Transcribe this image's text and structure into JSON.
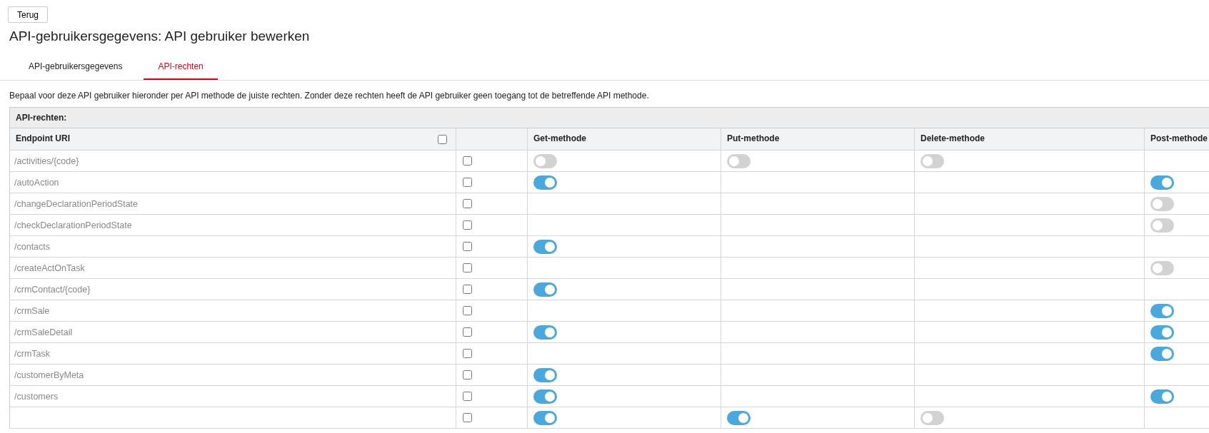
{
  "back_button": "Terug",
  "title": "API-gebruikersgegevens: API gebruiker bewerken",
  "tabs": [
    {
      "label": "API-gebruikersgegevens",
      "selected": false
    },
    {
      "label": "API-rechten",
      "selected": true
    }
  ],
  "description": "Bepaal voor deze API gebruiker hieronder per API methode de juiste rechten. Zonder deze rechten heeft de API gebruiker geen toegang tot de betreffende API methode.",
  "table": {
    "title": "API-rechten:",
    "columns": [
      "Endpoint URI",
      "Get-methode",
      "Put-methode",
      "Delete-methode",
      "Post-methode"
    ],
    "select_all_checked": false,
    "rows": [
      {
        "endpoint": "/activities/{code}",
        "checked": false,
        "get": false,
        "put": false,
        "delete": false,
        "post": null
      },
      {
        "endpoint": "/autoAction",
        "checked": false,
        "get": true,
        "put": null,
        "delete": null,
        "post": true
      },
      {
        "endpoint": "/changeDeclarationPeriodState",
        "checked": false,
        "get": null,
        "put": null,
        "delete": null,
        "post": false
      },
      {
        "endpoint": "/checkDeclarationPeriodState",
        "checked": false,
        "get": null,
        "put": null,
        "delete": null,
        "post": false
      },
      {
        "endpoint": "/contacts",
        "checked": false,
        "get": true,
        "put": null,
        "delete": null,
        "post": null
      },
      {
        "endpoint": "/createActOnTask",
        "checked": false,
        "get": null,
        "put": null,
        "delete": null,
        "post": false
      },
      {
        "endpoint": "/crmContact/{code}",
        "checked": false,
        "get": true,
        "put": null,
        "delete": null,
        "post": null
      },
      {
        "endpoint": "/crmSale",
        "checked": false,
        "get": null,
        "put": null,
        "delete": null,
        "post": true
      },
      {
        "endpoint": "/crmSaleDetail",
        "checked": false,
        "get": true,
        "put": null,
        "delete": null,
        "post": true
      },
      {
        "endpoint": "/crmTask",
        "checked": false,
        "get": null,
        "put": null,
        "delete": null,
        "post": true
      },
      {
        "endpoint": "/customerByMeta",
        "checked": false,
        "get": true,
        "put": null,
        "delete": null,
        "post": null
      },
      {
        "endpoint": "/customers",
        "checked": false,
        "get": true,
        "put": null,
        "delete": null,
        "post": true
      },
      {
        "checked": false,
        "get": true,
        "put": true,
        "delete": false,
        "post": null
      }
    ]
  }
}
